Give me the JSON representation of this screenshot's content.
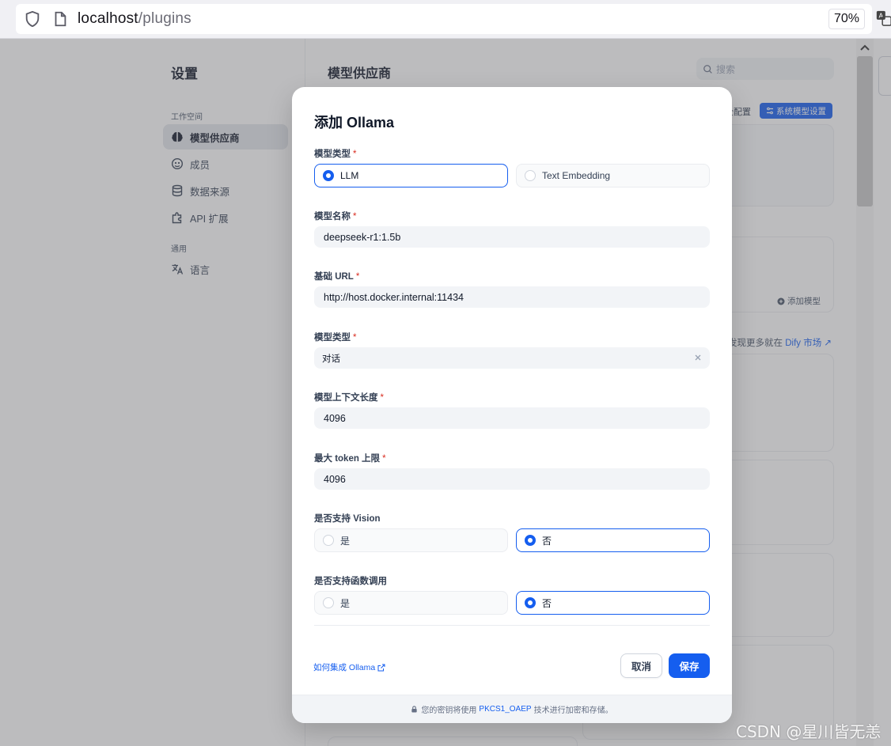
{
  "browser": {
    "url_host": "localhost",
    "url_path": "/plugins",
    "zoom": "70%"
  },
  "sidebar": {
    "title": "设置",
    "groups": [
      {
        "label": "工作空间"
      },
      {
        "label": "通用"
      }
    ],
    "items": [
      {
        "label": "模型供应商",
        "icon": "brain-icon",
        "active": true
      },
      {
        "label": "成员",
        "icon": "members-icon",
        "active": false
      },
      {
        "label": "数据来源",
        "icon": "database-icon",
        "active": false
      },
      {
        "label": "API 扩展",
        "icon": "puzzle-icon",
        "active": false
      },
      {
        "label": "语言",
        "icon": "translate-icon",
        "active": false
      }
    ]
  },
  "main": {
    "title": "模型供应商",
    "search_placeholder": "搜索",
    "security_config": "全配置",
    "system_model_settings": "系统模型设置",
    "add_model": "添加模型",
    "market_text": "发现更多就在 ",
    "market_link": "Dify 市场"
  },
  "modal": {
    "title": "添加 Ollama",
    "model_type": {
      "label": "模型类型",
      "options": [
        {
          "label": "LLM",
          "selected": true
        },
        {
          "label": "Text Embedding",
          "selected": false
        }
      ]
    },
    "model_name": {
      "label": "模型名称",
      "value": "deepseek-r1:1.5b"
    },
    "base_url": {
      "label": "基础 URL",
      "value": "http://host.docker.internal:11434"
    },
    "completion_type": {
      "label": "模型类型",
      "value": "对话"
    },
    "context_length": {
      "label": "模型上下文长度",
      "value": "4096"
    },
    "max_tokens": {
      "label": "最大 token 上限",
      "value": "4096"
    },
    "vision_support": {
      "label": "是否支持 Vision",
      "options": [
        {
          "label": "是",
          "selected": false
        },
        {
          "label": "否",
          "selected": true
        }
      ]
    },
    "function_call_support": {
      "label": "是否支持函数调用",
      "options": [
        {
          "label": "是",
          "selected": false
        },
        {
          "label": "否",
          "selected": true
        }
      ]
    },
    "help_link": "如何集成 Ollama",
    "cancel_label": "取消",
    "save_label": "保存",
    "footer": {
      "prefix": "您的密钥将使用",
      "link": "PKCS1_OAEP",
      "suffix": "技术进行加密和存储。"
    }
  },
  "watermark": "CSDN @星川皆无恙",
  "colors": {
    "primary": "#155eef",
    "required": "#d92d20"
  }
}
